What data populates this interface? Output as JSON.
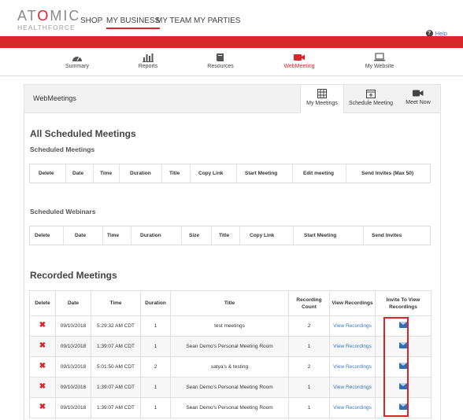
{
  "brand": {
    "line1_a": "AT",
    "line1_o": "O",
    "line1_b": "MIC",
    "line2": "HEALTHFORCE"
  },
  "topnav": {
    "items": [
      "SHOP",
      "MY BUSINESS",
      "MY TEAM",
      "MY PARTIES"
    ],
    "active": "MY BUSINESS"
  },
  "help": {
    "label": "Help"
  },
  "subnav": {
    "items": [
      {
        "label": "Summary",
        "icon": "gauge-icon"
      },
      {
        "label": "Reports",
        "icon": "bar-chart-icon"
      },
      {
        "label": "Resources",
        "icon": "book-icon"
      },
      {
        "label": "WebMeeting",
        "icon": "video-camera-icon"
      },
      {
        "label": "My Website",
        "icon": "laptop-icon"
      }
    ],
    "active": "WebMeeting"
  },
  "panel": {
    "title": "WebMeetings",
    "tabs": [
      {
        "label": "My Meetings",
        "icon": "grid-table-icon"
      },
      {
        "label": "Schedule Meeting",
        "icon": "calendar-plus-icon"
      },
      {
        "label": "Meet Now",
        "icon": "video-camera-icon"
      }
    ],
    "active_tab": "My Meetings"
  },
  "scheduled": {
    "heading": "All Scheduled Meetings",
    "meetings_subheading": "Scheduled Meetings",
    "meetings_columns": [
      "Delete",
      "Date",
      "Time",
      "Duration",
      "Title",
      "Copy Link",
      "Start Meeting",
      "Edit meeting",
      "Send Invites (Max 50)"
    ],
    "webinars_subheading": "Scheduled Webinars",
    "webinars_columns": [
      "Delete",
      "Date",
      "Time",
      "Duration",
      "Size",
      "Title",
      "Copy Link",
      "Start Meeting",
      "Send Invites"
    ]
  },
  "recorded": {
    "heading": "Recorded Meetings",
    "columns": [
      "Delete",
      "Date",
      "Time",
      "Duration",
      "Title",
      "Recording Count",
      "View Recordings",
      "Invite To View Recordings"
    ],
    "view_label": "View Recordings",
    "rows": [
      {
        "date": "09/10/2018",
        "time": "5:29:32 AM CDT",
        "duration": "1",
        "title": "test meetings",
        "count": "2"
      },
      {
        "date": "09/10/2018",
        "time": "1:39:07 AM CDT",
        "duration": "1",
        "title": "Sean Demo's Personal Meeting Room",
        "count": "1"
      },
      {
        "date": "09/10/2018",
        "time": "5:01:50 AM CDT",
        "duration": "2",
        "title": "satya's & testing",
        "count": "2"
      },
      {
        "date": "09/10/2018",
        "time": "1:39:07 AM CDT",
        "duration": "1",
        "title": "Sean Demo's Personal Meeting Room",
        "count": "1"
      },
      {
        "date": "09/10/2018",
        "time": "1:39:07 AM CDT",
        "duration": "1",
        "title": "Sean Demo's Personal Meeting Room",
        "count": "1"
      }
    ]
  },
  "colors": {
    "accent": "#d9262a",
    "link": "#3b78c2"
  }
}
